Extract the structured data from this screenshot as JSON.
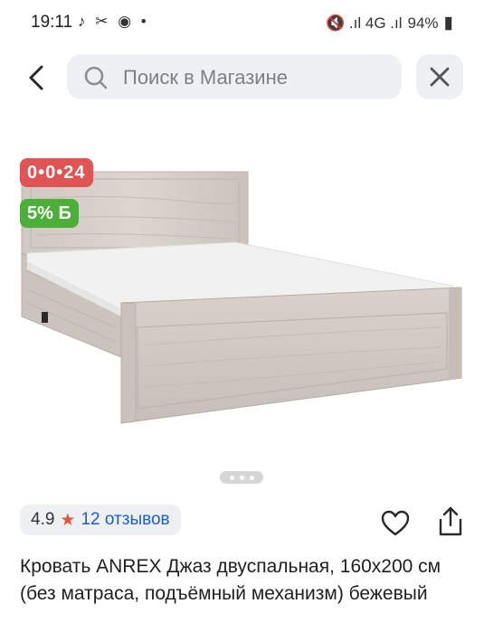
{
  "status_bar": {
    "time": "19:11",
    "left_icons": "♪ ✂ ◉ •",
    "right_icons": "🔇 .ıl 4G .ıl",
    "battery": "94%"
  },
  "search": {
    "placeholder": "Поиск в Магазине"
  },
  "badges": {
    "timer": "0•0•24",
    "discount": "5% Б"
  },
  "rating": {
    "value": "4.9",
    "reviews": "12 отзывов"
  },
  "product": {
    "title": "Кровать ANREX Джаз двуспальная, 160х200 см (без матраса, подъёмный механизм) бежевый"
  },
  "gallery": {
    "total": 3,
    "active": 1
  },
  "colors": {
    "timer_badge": "#e05454",
    "discount_badge": "#4caf3a",
    "reviews_link": "#1a5fc9",
    "star": "#e5533f"
  }
}
